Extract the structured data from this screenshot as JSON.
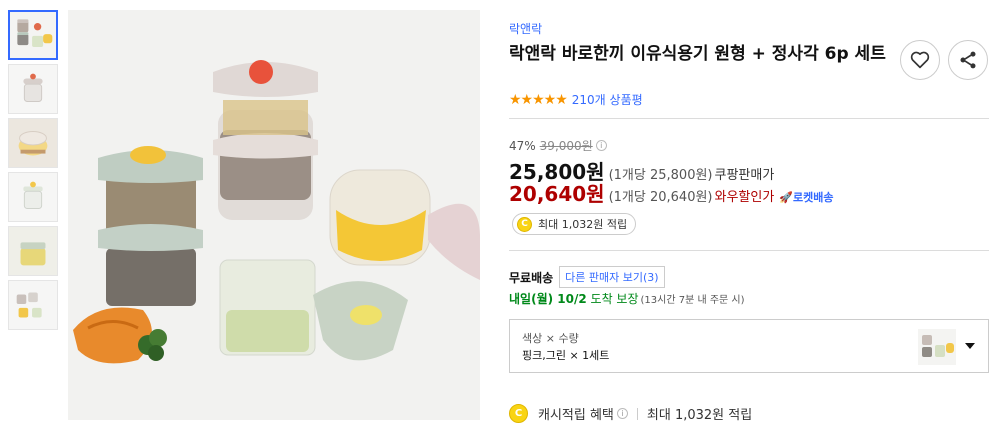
{
  "product": {
    "brand": "락앤락",
    "title": "락앤락 바로한끼 이유식용기 원형 + 정사각 6p 세트",
    "rating_stars": "★★★★★",
    "review_count": "210개 상품평"
  },
  "price": {
    "discount_rate": "47%",
    "original_price": "39,000원",
    "sale_price": "25,800원",
    "sale_unit": "(1개당 25,800원)",
    "sale_label": "쿠팡판매가",
    "wow_price": "20,640원",
    "wow_unit": "(1개당 20,640원)",
    "wow_label": "와우할인가",
    "rocket_label": "로켓배송"
  },
  "cash": {
    "coin_symbol": "C",
    "badge_text": "최대 1,032원 적립",
    "benefit_label": "캐시적립 혜택",
    "benefit_value": "최대 1,032원 적립"
  },
  "shipping": {
    "free_label": "무료배송",
    "other_sellers": "다른 판매자 보기(3)",
    "arrival_day": "내일(월) 10/2",
    "arrival_status": "도착 보장",
    "arrival_detail": "(13시간 7분 내 주문 시)"
  },
  "option": {
    "header": "색상 × 수량",
    "value": "핑크,그린 × 1세트"
  },
  "icons": {
    "heart": "heart-icon",
    "share": "share-icon",
    "info": "info-icon",
    "rocket": "rocket-icon",
    "coin": "coin-icon",
    "caret": "chevron-down-icon"
  },
  "colors": {
    "accent": "#346aff",
    "wow_red": "#ae0000",
    "star": "#f89500",
    "arrival_green": "#00891a"
  }
}
